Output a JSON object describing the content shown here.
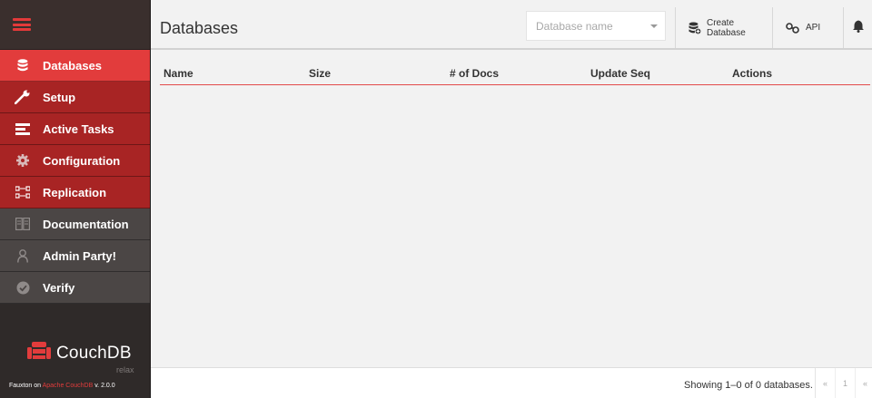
{
  "sidebar": {
    "items": [
      {
        "label": "Databases",
        "icon": "database-icon"
      },
      {
        "label": "Setup",
        "icon": "wrench-icon"
      },
      {
        "label": "Active Tasks",
        "icon": "tasks-icon"
      },
      {
        "label": "Configuration",
        "icon": "gear-icon"
      },
      {
        "label": "Replication",
        "icon": "replication-icon"
      },
      {
        "label": "Documentation",
        "icon": "book-icon"
      },
      {
        "label": "Admin Party!",
        "icon": "user-icon"
      },
      {
        "label": "Verify",
        "icon": "check-circle-icon"
      }
    ],
    "brand": {
      "name": "CouchDB",
      "tagline": "relax",
      "footer_prefix": "Fauxton on ",
      "footer_link": "Apache CouchDB",
      "footer_version": " v. 2.0.0"
    }
  },
  "header": {
    "title": "Databases",
    "search": {
      "placeholder": "Database name",
      "value": ""
    },
    "create_label": "Create Database",
    "api_label": "API"
  },
  "table": {
    "columns": [
      "Name",
      "Size",
      "# of Docs",
      "Update Seq",
      "Actions"
    ],
    "rows": []
  },
  "footer": {
    "showing": "Showing 1–0 of 0 databases.",
    "pager": [
      "«",
      "1",
      "«"
    ]
  },
  "colors": {
    "accent": "#e23c3c",
    "nav_red": "#a82424",
    "nav_gray": "#4b4645",
    "sidebar_bg": "#2f2a29"
  }
}
